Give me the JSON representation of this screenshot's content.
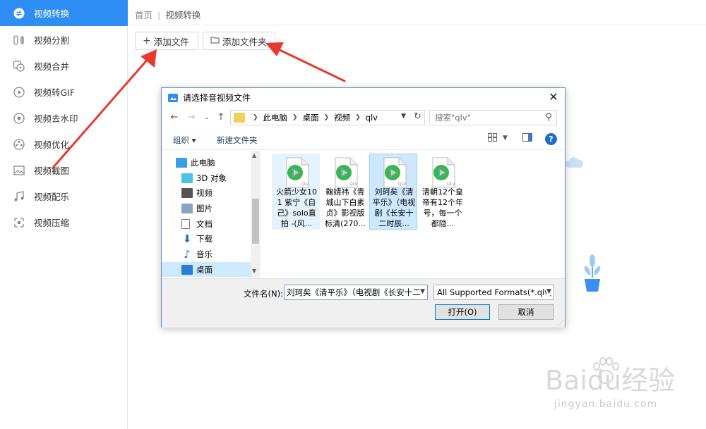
{
  "sidebar": {
    "items": [
      {
        "label": "视频转换",
        "icon": "convert-icon",
        "active": true
      },
      {
        "label": "视频分割",
        "icon": "split-icon"
      },
      {
        "label": "视频合并",
        "icon": "merge-icon"
      },
      {
        "label": "视频转GIF",
        "icon": "gif-icon"
      },
      {
        "label": "视频去水印",
        "icon": "watermark-icon"
      },
      {
        "label": "视频优化",
        "icon": "optimize-icon"
      },
      {
        "label": "视频截图",
        "icon": "screenshot-icon"
      },
      {
        "label": "视频配乐",
        "icon": "music-icon"
      },
      {
        "label": "视频压缩",
        "icon": "compress-icon"
      }
    ]
  },
  "breadcrumb": {
    "home": "首页",
    "separator": "|",
    "current": "视频转换"
  },
  "toolbar": {
    "add_file": "添加文件",
    "add_folder": "添加文件夹"
  },
  "dialog": {
    "title": "请选择音视频文件",
    "path": [
      "此电脑",
      "桌面",
      "视频",
      "qlv"
    ],
    "search_placeholder": "搜索\"qlv\"",
    "organize": "组织 ▾",
    "new_folder": "新建文件夹",
    "help": "?",
    "tree": [
      {
        "label": "此电脑",
        "icon": "computer-icon"
      },
      {
        "label": "3D 对象",
        "icon": "3d-objects-icon"
      },
      {
        "label": "视频",
        "icon": "videos-folder-icon"
      },
      {
        "label": "图片",
        "icon": "pictures-folder-icon"
      },
      {
        "label": "文档",
        "icon": "documents-folder-icon"
      },
      {
        "label": "下载",
        "icon": "downloads-folder-icon"
      },
      {
        "label": "音乐",
        "icon": "music-folder-icon"
      },
      {
        "label": "桌面",
        "icon": "desktop-folder-icon",
        "selected": true
      }
    ],
    "files": [
      {
        "name": "火箭少女101 紫宁《自己》solo直拍 -(风...",
        "badge": "QLV",
        "state": "hover"
      },
      {
        "name": "鞠婧祎《青城山下白素贞》影视版标清(270...",
        "badge": "QLV"
      },
      {
        "name": "刘珂矣《清平乐》（电视剧《长安十二时辰...",
        "badge": "QLV",
        "state": "selected"
      },
      {
        "name": "清朝12个皇帝有12个年号，每一个都隐...",
        "badge": "QLV"
      }
    ],
    "filename_label": "文件名(N):",
    "filename_value": "刘珂矣《清平乐》（电视剧《长安十二",
    "filter_value": "All Supported Formats(*.qlv;",
    "open_button": "打开(O)",
    "cancel_button": "取消"
  },
  "watermark": {
    "brand": "Baidu经验",
    "url": "jingyan.baidu.com"
  },
  "colors": {
    "accent": "#2f8ef4",
    "annotation": "#e8392f",
    "selection": "#cce8ff"
  }
}
